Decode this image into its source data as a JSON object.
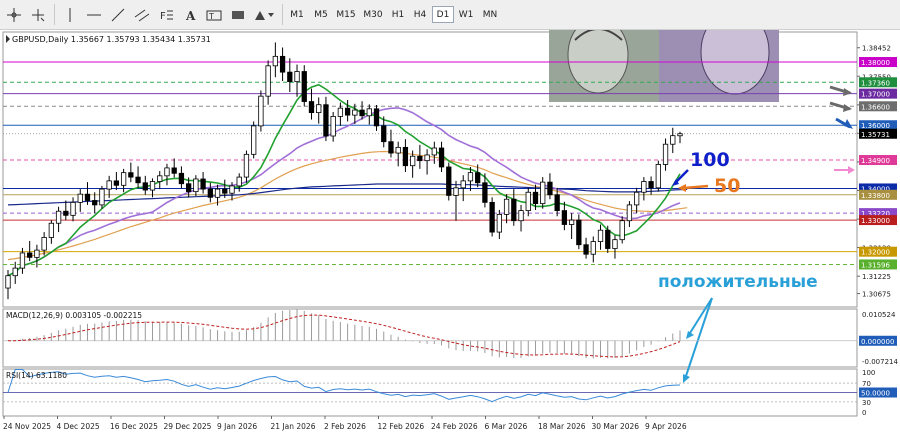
{
  "toolbar": {
    "timeframes": [
      "M1",
      "M5",
      "M15",
      "M30",
      "H1",
      "H4",
      "D1",
      "W1",
      "MN"
    ],
    "active_timeframe": "D1",
    "tools": [
      "crosshair-icon",
      "cursor-plus-icon",
      "horizontal-line-icon",
      "trendline-icon",
      "channel-icon",
      "fibonacci-icon",
      "text-icon",
      "label-icon",
      "rectangle-icon",
      "shapes-icon"
    ]
  },
  "chart_data": {
    "type": "candlestick",
    "symbol_info": "GBPUSD,Daily  1.35667 1.35793 1.35434 1.35731",
    "price_axis": {
      "range": [
        1.3025,
        1.3895
      ],
      "ticks": [
        "1.38452",
        "1.37550",
        "1.36645",
        "1.35745",
        "1.34840",
        "1.33935",
        "1.33030",
        "1.32130",
        "1.31225",
        "1.30675"
      ]
    },
    "date_labels": [
      "24 Nov 2025",
      "4 Dec 2025",
      "16 Dec 2025",
      "29 Dec 2025",
      "9 Jan 2026",
      "21 Jan 2026",
      "2 Feb 2026",
      "12 Feb 2026",
      "24 Feb 2026",
      "6 Mar 2026",
      "18 Mar 2026",
      "30 Mar 2026",
      "9 Apr 2026"
    ],
    "level_lines": [
      {
        "label": "1.38000",
        "value": 1.38,
        "color": "#d400d4",
        "badge": "#c800c8",
        "style": "solid"
      },
      {
        "label": "1.37360",
        "value": 1.3736,
        "color": "#33a852",
        "badge": "#1f8f3e",
        "style": "dash"
      },
      {
        "label": "1.37000",
        "value": 1.37,
        "color": "#7a3fb0",
        "badge": "#6b2aa0",
        "style": "solid"
      },
      {
        "label": "1.36600",
        "value": 1.366,
        "color": "#8a8a8a",
        "badge": "#6d6d6d",
        "style": "dash"
      },
      {
        "label": "1.36000",
        "value": 1.36,
        "color": "#1f5db8",
        "badge": "#1f5db8",
        "style": "solid"
      },
      {
        "label": "1.34900",
        "value": 1.349,
        "color": "#e64fa8",
        "badge": "#e03a98",
        "style": "dash"
      },
      {
        "label": "1.34000",
        "value": 1.34,
        "color": "#0a2aa8",
        "badge": "#0a2aa8",
        "style": "solid"
      },
      {
        "label": "1.33800",
        "value": 1.338,
        "color": "#b8a05c",
        "badge": "#a89040",
        "style": "solid"
      },
      {
        "label": "1.33220",
        "value": 1.3322,
        "color": "#9a60d0",
        "badge": "#8a48c8",
        "style": "dash"
      },
      {
        "label": "1.33000",
        "value": 1.33,
        "color": "#c83232",
        "badge": "#b81e1e",
        "style": "solid"
      },
      {
        "label": "1.32000",
        "value": 1.32,
        "color": "#d4a800",
        "badge": "#c89800",
        "style": "solid"
      },
      {
        "label": "1.31596",
        "value": 1.31596,
        "color": "#66b83a",
        "badge": "#58b02c",
        "style": "dash"
      }
    ],
    "current_price": {
      "label": "1.35731",
      "value": 1.35731
    },
    "candles": [
      {
        "o": 1.3085,
        "h": 1.3142,
        "l": 1.305,
        "c": 1.3124
      },
      {
        "o": 1.3124,
        "h": 1.3168,
        "l": 1.3098,
        "c": 1.3148
      },
      {
        "o": 1.3148,
        "h": 1.3212,
        "l": 1.313,
        "c": 1.3196
      },
      {
        "o": 1.3196,
        "h": 1.3234,
        "l": 1.317,
        "c": 1.3182
      },
      {
        "o": 1.3182,
        "h": 1.3222,
        "l": 1.315,
        "c": 1.3205
      },
      {
        "o": 1.3205,
        "h": 1.3262,
        "l": 1.3188,
        "c": 1.3245
      },
      {
        "o": 1.3245,
        "h": 1.33,
        "l": 1.3225,
        "c": 1.329
      },
      {
        "o": 1.329,
        "h": 1.3342,
        "l": 1.3262,
        "c": 1.3328
      },
      {
        "o": 1.3328,
        "h": 1.3362,
        "l": 1.33,
        "c": 1.3315
      },
      {
        "o": 1.3315,
        "h": 1.3372,
        "l": 1.3296,
        "c": 1.3356
      },
      {
        "o": 1.3356,
        "h": 1.3398,
        "l": 1.3326,
        "c": 1.3382
      },
      {
        "o": 1.3382,
        "h": 1.342,
        "l": 1.3348,
        "c": 1.3362
      },
      {
        "o": 1.3362,
        "h": 1.3388,
        "l": 1.3322,
        "c": 1.3348
      },
      {
        "o": 1.3348,
        "h": 1.3408,
        "l": 1.3336,
        "c": 1.3398
      },
      {
        "o": 1.3398,
        "h": 1.344,
        "l": 1.337,
        "c": 1.3424
      },
      {
        "o": 1.3424,
        "h": 1.3452,
        "l": 1.3395,
        "c": 1.341
      },
      {
        "o": 1.341,
        "h": 1.3462,
        "l": 1.3388,
        "c": 1.345
      },
      {
        "o": 1.345,
        "h": 1.3482,
        "l": 1.342,
        "c": 1.3436
      },
      {
        "o": 1.3436,
        "h": 1.347,
        "l": 1.3402,
        "c": 1.3418
      },
      {
        "o": 1.3418,
        "h": 1.344,
        "l": 1.338,
        "c": 1.3395
      },
      {
        "o": 1.3395,
        "h": 1.3432,
        "l": 1.3372,
        "c": 1.3422
      },
      {
        "o": 1.3422,
        "h": 1.3455,
        "l": 1.3398,
        "c": 1.344
      },
      {
        "o": 1.344,
        "h": 1.3478,
        "l": 1.341,
        "c": 1.3465
      },
      {
        "o": 1.3465,
        "h": 1.3495,
        "l": 1.3434,
        "c": 1.3448
      },
      {
        "o": 1.3448,
        "h": 1.347,
        "l": 1.34,
        "c": 1.3415
      },
      {
        "o": 1.3415,
        "h": 1.3435,
        "l": 1.3372,
        "c": 1.339
      },
      {
        "o": 1.339,
        "h": 1.3442,
        "l": 1.3376,
        "c": 1.343
      },
      {
        "o": 1.343,
        "h": 1.3452,
        "l": 1.3384,
        "c": 1.3398
      },
      {
        "o": 1.3398,
        "h": 1.3418,
        "l": 1.3356,
        "c": 1.3372
      },
      {
        "o": 1.3372,
        "h": 1.3412,
        "l": 1.3346,
        "c": 1.3398
      },
      {
        "o": 1.3398,
        "h": 1.3428,
        "l": 1.337,
        "c": 1.3385
      },
      {
        "o": 1.3385,
        "h": 1.342,
        "l": 1.3362,
        "c": 1.3408
      },
      {
        "o": 1.3408,
        "h": 1.3448,
        "l": 1.339,
        "c": 1.3436
      },
      {
        "o": 1.3436,
        "h": 1.352,
        "l": 1.3418,
        "c": 1.3508
      },
      {
        "o": 1.3508,
        "h": 1.3612,
        "l": 1.3495,
        "c": 1.3598
      },
      {
        "o": 1.3598,
        "h": 1.371,
        "l": 1.358,
        "c": 1.3692
      },
      {
        "o": 1.3692,
        "h": 1.3805,
        "l": 1.3665,
        "c": 1.3788
      },
      {
        "o": 1.3788,
        "h": 1.3862,
        "l": 1.3752,
        "c": 1.3818
      },
      {
        "o": 1.3818,
        "h": 1.3846,
        "l": 1.374,
        "c": 1.3768
      },
      {
        "o": 1.3768,
        "h": 1.3812,
        "l": 1.3705,
        "c": 1.3738
      },
      {
        "o": 1.3738,
        "h": 1.3792,
        "l": 1.369,
        "c": 1.377
      },
      {
        "o": 1.377,
        "h": 1.379,
        "l": 1.366,
        "c": 1.3675
      },
      {
        "o": 1.3675,
        "h": 1.3716,
        "l": 1.3618,
        "c": 1.364
      },
      {
        "o": 1.364,
        "h": 1.3688,
        "l": 1.3605,
        "c": 1.3665
      },
      {
        "o": 1.3665,
        "h": 1.369,
        "l": 1.355,
        "c": 1.3566
      },
      {
        "o": 1.3566,
        "h": 1.3642,
        "l": 1.3548,
        "c": 1.3628
      },
      {
        "o": 1.3628,
        "h": 1.3672,
        "l": 1.3598,
        "c": 1.3654
      },
      {
        "o": 1.3654,
        "h": 1.368,
        "l": 1.3612,
        "c": 1.3632
      },
      {
        "o": 1.3632,
        "h": 1.3668,
        "l": 1.3604,
        "c": 1.3648
      },
      {
        "o": 1.3648,
        "h": 1.3676,
        "l": 1.3618,
        "c": 1.363
      },
      {
        "o": 1.363,
        "h": 1.3666,
        "l": 1.3602,
        "c": 1.3652
      },
      {
        "o": 1.3652,
        "h": 1.3664,
        "l": 1.3582,
        "c": 1.3598
      },
      {
        "o": 1.3598,
        "h": 1.3628,
        "l": 1.353,
        "c": 1.3548
      },
      {
        "o": 1.3548,
        "h": 1.3586,
        "l": 1.3498,
        "c": 1.3512
      },
      {
        "o": 1.3512,
        "h": 1.3548,
        "l": 1.347,
        "c": 1.353
      },
      {
        "o": 1.353,
        "h": 1.3556,
        "l": 1.3452,
        "c": 1.3472
      },
      {
        "o": 1.3472,
        "h": 1.352,
        "l": 1.3434,
        "c": 1.3502
      },
      {
        "o": 1.3502,
        "h": 1.3538,
        "l": 1.3462,
        "c": 1.3488
      },
      {
        "o": 1.3488,
        "h": 1.3524,
        "l": 1.3444,
        "c": 1.3506
      },
      {
        "o": 1.3506,
        "h": 1.3548,
        "l": 1.3478,
        "c": 1.3528
      },
      {
        "o": 1.3528,
        "h": 1.3548,
        "l": 1.3452,
        "c": 1.3468
      },
      {
        "o": 1.3468,
        "h": 1.3482,
        "l": 1.3362,
        "c": 1.3378
      },
      {
        "o": 1.3378,
        "h": 1.3424,
        "l": 1.3298,
        "c": 1.3402
      },
      {
        "o": 1.3402,
        "h": 1.3442,
        "l": 1.336,
        "c": 1.3424
      },
      {
        "o": 1.3424,
        "h": 1.3468,
        "l": 1.3392,
        "c": 1.345
      },
      {
        "o": 1.345,
        "h": 1.3476,
        "l": 1.3404,
        "c": 1.3418
      },
      {
        "o": 1.3418,
        "h": 1.3448,
        "l": 1.334,
        "c": 1.3356
      },
      {
        "o": 1.3356,
        "h": 1.3372,
        "l": 1.3248,
        "c": 1.3262
      },
      {
        "o": 1.3262,
        "h": 1.3332,
        "l": 1.324,
        "c": 1.3318
      },
      {
        "o": 1.3318,
        "h": 1.3382,
        "l": 1.329,
        "c": 1.3366
      },
      {
        "o": 1.3366,
        "h": 1.3398,
        "l": 1.3282,
        "c": 1.3298
      },
      {
        "o": 1.3298,
        "h": 1.3348,
        "l": 1.3264,
        "c": 1.333
      },
      {
        "o": 1.333,
        "h": 1.3402,
        "l": 1.3312,
        "c": 1.3388
      },
      {
        "o": 1.3388,
        "h": 1.3412,
        "l": 1.3332,
        "c": 1.3352
      },
      {
        "o": 1.3352,
        "h": 1.3436,
        "l": 1.3336,
        "c": 1.342
      },
      {
        "o": 1.342,
        "h": 1.3448,
        "l": 1.3366,
        "c": 1.338
      },
      {
        "o": 1.338,
        "h": 1.3402,
        "l": 1.3312,
        "c": 1.333
      },
      {
        "o": 1.333,
        "h": 1.3358,
        "l": 1.3268,
        "c": 1.3286
      },
      {
        "o": 1.3286,
        "h": 1.3322,
        "l": 1.324,
        "c": 1.33
      },
      {
        "o": 1.33,
        "h": 1.3318,
        "l": 1.3208,
        "c": 1.3222
      },
      {
        "o": 1.3222,
        "h": 1.3244,
        "l": 1.3178,
        "c": 1.3192
      },
      {
        "o": 1.3192,
        "h": 1.3248,
        "l": 1.3166,
        "c": 1.3232
      },
      {
        "o": 1.3232,
        "h": 1.3286,
        "l": 1.3206,
        "c": 1.3268
      },
      {
        "o": 1.3268,
        "h": 1.3282,
        "l": 1.3196,
        "c": 1.321
      },
      {
        "o": 1.321,
        "h": 1.3252,
        "l": 1.3178,
        "c": 1.3238
      },
      {
        "o": 1.3238,
        "h": 1.3312,
        "l": 1.3226,
        "c": 1.3298
      },
      {
        "o": 1.3298,
        "h": 1.336,
        "l": 1.3278,
        "c": 1.3348
      },
      {
        "o": 1.3348,
        "h": 1.3402,
        "l": 1.3322,
        "c": 1.3388
      },
      {
        "o": 1.3388,
        "h": 1.3436,
        "l": 1.3362,
        "c": 1.3422
      },
      {
        "o": 1.3422,
        "h": 1.3438,
        "l": 1.338,
        "c": 1.3402
      },
      {
        "o": 1.3402,
        "h": 1.3488,
        "l": 1.339,
        "c": 1.3476
      },
      {
        "o": 1.3476,
        "h": 1.3558,
        "l": 1.3456,
        "c": 1.354
      },
      {
        "o": 1.354,
        "h": 1.3592,
        "l": 1.3512,
        "c": 1.3567
      },
      {
        "o": 1.35667,
        "h": 1.35793,
        "l": 1.35434,
        "c": 1.35731
      }
    ],
    "moving_averages": [
      {
        "name": "50",
        "color": "#e0a050",
        "values": [
          1.3175,
          1.3178,
          1.3182,
          1.3186,
          1.319,
          1.3195,
          1.32,
          1.3206,
          1.3212,
          1.3218,
          1.3225,
          1.3232,
          1.3239,
          1.3247,
          1.3255,
          1.3263,
          1.3271,
          1.3279,
          1.3286,
          1.3293,
          1.33,
          1.3307,
          1.3315,
          1.3322,
          1.3328,
          1.3334,
          1.334,
          1.3346,
          1.3351,
          1.3356,
          1.3361,
          1.3366,
          1.3372,
          1.338,
          1.339,
          1.3402,
          1.3416,
          1.343,
          1.3442,
          1.3453,
          1.3463,
          1.3471,
          1.3478,
          1.3484,
          1.3489,
          1.3494,
          1.3499,
          1.3503,
          1.3507,
          1.3511,
          1.3514,
          1.3516,
          1.3517,
          1.3516,
          1.3514,
          1.3511,
          1.3508,
          1.3505,
          1.3502,
          1.3499,
          1.3495,
          1.3489,
          1.3483,
          1.3478,
          1.3473,
          1.3467,
          1.3459,
          1.3449,
          1.3441,
          1.3434,
          1.3426,
          1.3419,
          1.3413,
          1.3407,
          1.3402,
          1.3397,
          1.3391,
          1.3385,
          1.3379,
          1.3371,
          1.3363,
          1.3356,
          1.335,
          1.3344,
          1.3338,
          1.3334,
          1.3331,
          1.3329,
          1.3328,
          1.3327,
          1.3328,
          1.333,
          1.3333,
          1.3336,
          1.3339
        ]
      },
      {
        "name": "100",
        "color": "#1a2a8c",
        "values": [
          1.3348,
          1.3349,
          1.335,
          1.3351,
          1.3352,
          1.3353,
          1.3354,
          1.3355,
          1.3356,
          1.3357,
          1.3358,
          1.3359,
          1.336,
          1.3361,
          1.3362,
          1.3363,
          1.3364,
          1.3365,
          1.3366,
          1.3367,
          1.3368,
          1.3369,
          1.337,
          1.3371,
          1.3372,
          1.3373,
          1.3374,
          1.3375,
          1.3376,
          1.3377,
          1.3378,
          1.3379,
          1.338,
          1.3382,
          1.3384,
          1.3387,
          1.339,
          1.3393,
          1.3396,
          1.3399,
          1.3401,
          1.3403,
          1.3405,
          1.3406,
          1.3407,
          1.3408,
          1.3409,
          1.341,
          1.3411,
          1.3412,
          1.3413,
          1.3414,
          1.3414,
          1.3414,
          1.3414,
          1.3414,
          1.3414,
          1.3414,
          1.3414,
          1.3414,
          1.3414,
          1.3413,
          1.3412,
          1.3412,
          1.3412,
          1.3411,
          1.341,
          1.3408,
          1.3407,
          1.3406,
          1.3405,
          1.3404,
          1.3403,
          1.3402,
          1.3401,
          1.34,
          1.3399,
          1.3398,
          1.3397,
          1.3395,
          1.3393,
          1.3392,
          1.3391,
          1.339,
          1.3389,
          1.3389,
          1.3389,
          1.3389,
          1.339,
          1.3391,
          1.3392,
          1.3393,
          1.3395,
          1.3396,
          1.3397
        ]
      }
    ],
    "annotations": [
      {
        "text": "100",
        "color": "#1020c8"
      },
      {
        "text": "50",
        "color": "#e87820"
      },
      {
        "text": "положительные",
        "color": "#2aa0d8"
      }
    ],
    "macd": {
      "label": "MACD(12,26,9) 0.003105 -0.002215",
      "axis_labels": [
        "0.010524",
        "0.000000",
        "-0.007214"
      ],
      "range": [
        -0.0095,
        0.0115
      ],
      "zero_label": "0.000000"
    },
    "rsi": {
      "label": "RSI(14) 63.1180",
      "axis_labels": [
        "100",
        "70",
        "50",
        "30",
        "0"
      ],
      "highlight": "50.0000",
      "range": [
        0,
        100
      ]
    }
  }
}
